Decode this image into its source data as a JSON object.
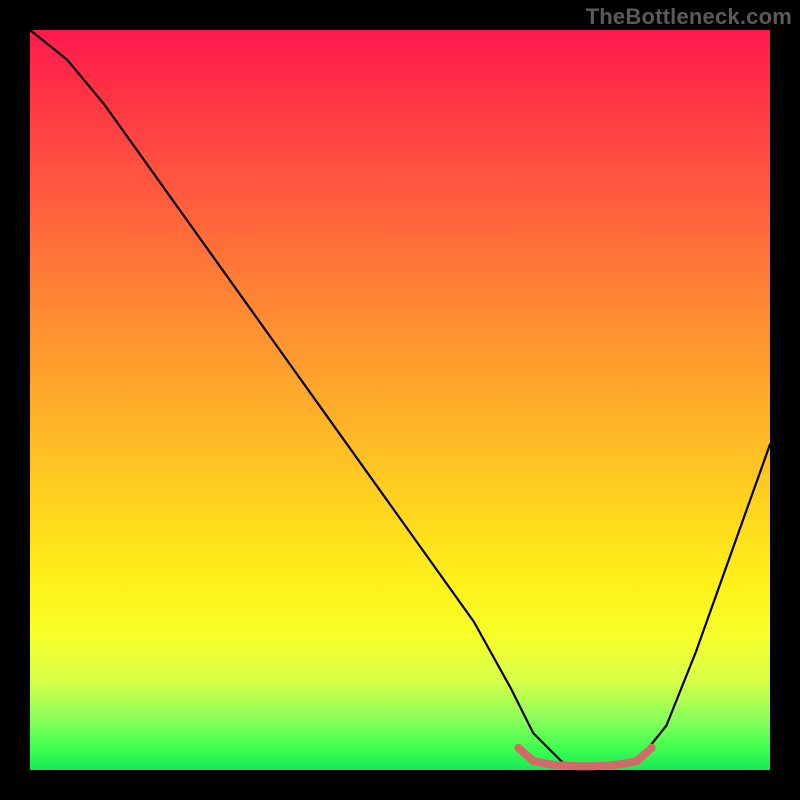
{
  "watermark": "TheBottleneck.com",
  "chart_data": {
    "type": "line",
    "title": "",
    "xlabel": "",
    "ylabel": "",
    "xlim": [
      0,
      100
    ],
    "ylim": [
      0,
      100
    ],
    "series": [
      {
        "name": "bottleneck-curve",
        "x": [
          0,
          5,
          10,
          20,
          30,
          40,
          50,
          60,
          65,
          68,
          72,
          75,
          78,
          82,
          86,
          90,
          95,
          100
        ],
        "values": [
          100,
          96,
          90,
          76,
          62,
          48,
          34,
          20,
          11,
          5,
          1,
          0.5,
          0.5,
          1,
          6,
          16,
          30,
          44
        ]
      },
      {
        "name": "optimal-range",
        "x": [
          66,
          68,
          70,
          72,
          74,
          76,
          78,
          80,
          82,
          84
        ],
        "values": [
          3,
          1.2,
          0.8,
          0.6,
          0.5,
          0.5,
          0.6,
          0.8,
          1.2,
          3
        ]
      }
    ],
    "colors": {
      "curve": "#000000",
      "optimal": "#d36a6a",
      "gradient_top": "#ff1a4e",
      "gradient_mid": "#ffd61e",
      "gradient_bottom": "#18e858"
    }
  }
}
